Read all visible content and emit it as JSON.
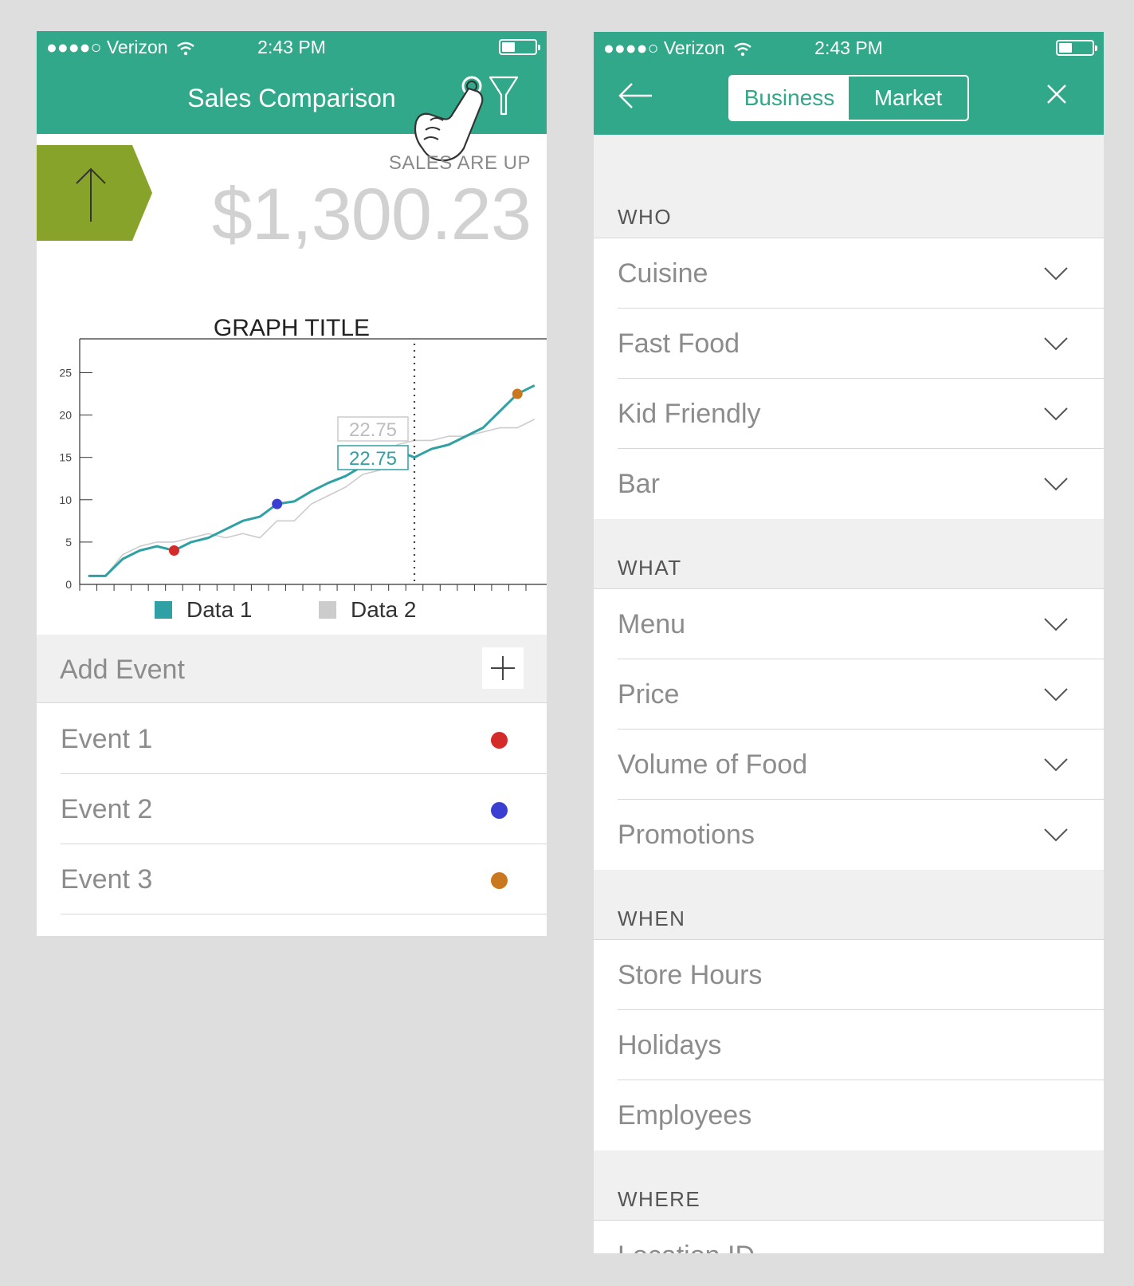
{
  "colors": {
    "primary": "#32a88a",
    "up_box": "#88a32a",
    "data1": "#2fa1a4",
    "data2": "#cccccc",
    "event1": "#d42a2a",
    "event2": "#3b3fd1",
    "event3": "#c9781f"
  },
  "status": {
    "carrier": "●●●●○ Verizon",
    "time": "2:43 PM"
  },
  "left": {
    "title": "Sales Comparison",
    "filter_icon": "filter-icon",
    "sales_label": "SALES ARE UP",
    "sales_value": "$1,300.23",
    "add_event_label": "Add Event",
    "events": [
      {
        "label": "Event 1",
        "color": "#d42a2a"
      },
      {
        "label": "Event 2",
        "color": "#3b3fd1"
      },
      {
        "label": "Event 3",
        "color": "#c9781f"
      }
    ]
  },
  "right": {
    "tabs": [
      "Business",
      "Market"
    ],
    "sections": [
      {
        "title": "WHO",
        "items": [
          "Cuisine",
          "Fast Food",
          "Kid Friendly",
          "Bar"
        ],
        "dropdown": true
      },
      {
        "title": "WHAT",
        "items": [
          "Menu",
          "Price",
          "Volume of Food",
          "Promotions"
        ],
        "dropdown": true
      },
      {
        "title": "WHEN",
        "items": [
          "Store Hours",
          "Holidays",
          "Employees"
        ],
        "dropdown": false
      },
      {
        "title": "WHERE",
        "items": [
          "Location ID"
        ],
        "dropdown": false
      }
    ]
  },
  "chart_data": {
    "type": "line",
    "title": "GRAPH TITLE",
    "yticks": [
      0,
      5,
      10,
      15,
      20,
      25
    ],
    "ylim": [
      0,
      29
    ],
    "xlim": [
      0,
      26
    ],
    "grid": false,
    "legend": "bottom",
    "series": [
      {
        "name": "Data 1",
        "color": "#2fa1a4",
        "x": [
          0.5,
          1.5,
          2.5,
          3.5,
          4.5,
          5.5,
          6.5,
          7.5,
          8.5,
          9.5,
          10.5,
          11.5,
          12.5,
          13.5,
          14.5,
          15.5,
          16.5,
          17.5,
          18.5,
          19.5,
          20.5,
          21.5,
          22.5,
          23.5,
          24.5,
          25.5,
          26.5
        ],
        "y": [
          1,
          1,
          3,
          4,
          4.5,
          4,
          5,
          5.5,
          6.5,
          7.5,
          8,
          9.5,
          9.8,
          11,
          12,
          12.8,
          14,
          15.2,
          15.8,
          15,
          16,
          16.5,
          17.5,
          18.5,
          20.5,
          22.5,
          23.5
        ]
      },
      {
        "name": "Data 2",
        "color": "#cccccc",
        "x": [
          0.5,
          1.5,
          2.5,
          3.5,
          4.5,
          5.5,
          6.5,
          7.5,
          8.5,
          9.5,
          10.5,
          11.5,
          12.5,
          13.5,
          14.5,
          15.5,
          16.5,
          17.5,
          18.5,
          19.5,
          20.5,
          21.5,
          22.5,
          23.5,
          24.5,
          25.5,
          26.5
        ],
        "y": [
          1,
          1,
          3.5,
          4.5,
          5,
          5,
          5.5,
          6,
          5.5,
          6,
          5.5,
          7.5,
          7.5,
          9.5,
          10.5,
          11.5,
          13,
          13.5,
          16.5,
          17,
          17,
          17.5,
          17.5,
          18,
          18.5,
          18.5,
          19.5
        ]
      }
    ],
    "markers": [
      {
        "event": "Event 1",
        "x": 5.5,
        "y": 4,
        "color": "#d42a2a"
      },
      {
        "event": "Event 2",
        "x": 11.5,
        "y": 9.5,
        "color": "#3b3fd1"
      },
      {
        "event": "Event 3",
        "x": 25.5,
        "y": 22.5,
        "color": "#c9781f"
      }
    ],
    "cursor": {
      "x": 19.5,
      "labels": [
        {
          "text": "22.75",
          "series": "Data 2"
        },
        {
          "text": "22.75",
          "series": "Data 1"
        }
      ]
    }
  }
}
